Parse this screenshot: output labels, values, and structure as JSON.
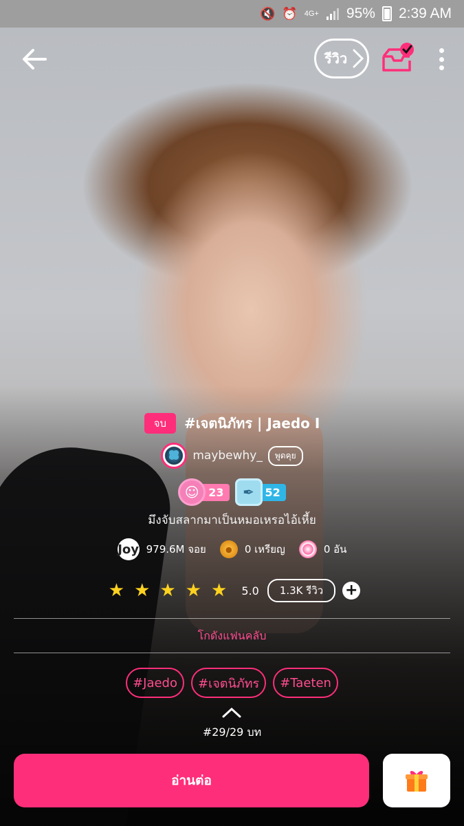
{
  "statusbar": {
    "network": "4G+",
    "battery": "95%",
    "time": "2:39 AM",
    "icons": [
      "mute-icon",
      "alarm-icon",
      "signal-icon",
      "battery-icon"
    ]
  },
  "header": {
    "review_label": "รีวิว"
  },
  "story": {
    "status_badge": "จบ",
    "title": "#เจตนิภัทร | Jaedo I",
    "author": "maybewhy_",
    "chat_label": "พูดคุย",
    "reader_level": "23",
    "writer_level": "52",
    "bio": "มึงจับสลากมาเป็นหมอเหรอไอ้เหี้ย",
    "joy_badge": "Joy",
    "joy": "979.6M จอย",
    "coins": "0 เหรียญ",
    "candy": "0 อัน"
  },
  "rating": {
    "stars": 5,
    "score": "5.0",
    "reviews_label": "1.3K รีวิว",
    "add_label": "+"
  },
  "fanclub_label": "โกดังแฟนคลับ",
  "tags": [
    "#Jaedo",
    "#เจตนิภัทร",
    "#Taeten"
  ],
  "chapter_info": "#29/29 บท",
  "read_button": "อ่านต่อ",
  "colors": {
    "accent": "#ff2e7a",
    "star": "#ffd21f",
    "statusbar": "#9e9e9e"
  }
}
